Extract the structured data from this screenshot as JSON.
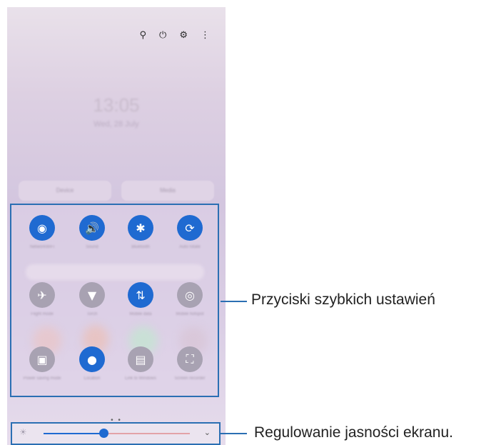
{
  "top_icons": [
    "search-icon",
    "power-icon",
    "gear-icon",
    "more-icon"
  ],
  "top_icon_glyphs": [
    "⚲",
    "⏻",
    "⚙",
    "⋮"
  ],
  "clock": {
    "time": "13:05",
    "date": "Wed, 28 July"
  },
  "quick_panel_buttons": [
    "Device",
    "Media"
  ],
  "quick_settings": {
    "row1": [
      {
        "icon": "wifi-icon",
        "glyph": "◉",
        "state": "on",
        "label": "NetworkWiFi"
      },
      {
        "icon": "sound-icon",
        "glyph": "🔊",
        "state": "on",
        "label": "Sound"
      },
      {
        "icon": "bluetooth-icon",
        "glyph": "✱",
        "state": "on",
        "label": "Bluetooth"
      },
      {
        "icon": "auto-rotate-icon",
        "glyph": "⟳",
        "state": "on",
        "label": "Auto rotate"
      }
    ],
    "row2": [
      {
        "icon": "airplane-icon",
        "glyph": "✈",
        "state": "off",
        "label": "Flight mode"
      },
      {
        "icon": "flashlight-icon",
        "glyph": "▼",
        "state": "off",
        "label": "Torch"
      },
      {
        "icon": "mobile-data-icon",
        "glyph": "⇅",
        "state": "on",
        "label": "Mobile data"
      },
      {
        "icon": "hotspot-icon",
        "glyph": "◎",
        "state": "off",
        "label": "Mobile hotspot"
      }
    ],
    "row3": [
      {
        "icon": "power-saving-icon",
        "glyph": "▣",
        "state": "off",
        "label": "Power saving mode"
      },
      {
        "icon": "location-icon",
        "glyph": "●",
        "state": "on",
        "label": "Location"
      },
      {
        "icon": "link-to-windows-icon",
        "glyph": "▤",
        "state": "off",
        "label": "Link to Windows"
      },
      {
        "icon": "screen-recorder-icon",
        "glyph": "⛶",
        "state": "off",
        "label": "Screen recorder"
      }
    ]
  },
  "page_dots": "• •",
  "brightness": {
    "level_percent": 35,
    "sun_glyph": "☀",
    "expand_glyph": "⌄"
  },
  "callouts": {
    "quick_settings": "Przyciski szybkich ustawień",
    "brightness": "Regulowanie jasności ekranu."
  },
  "colors": {
    "accent": "#1f6ad1",
    "callout_border": "#2b6fb3",
    "tile_off": "#a8a2b2"
  }
}
